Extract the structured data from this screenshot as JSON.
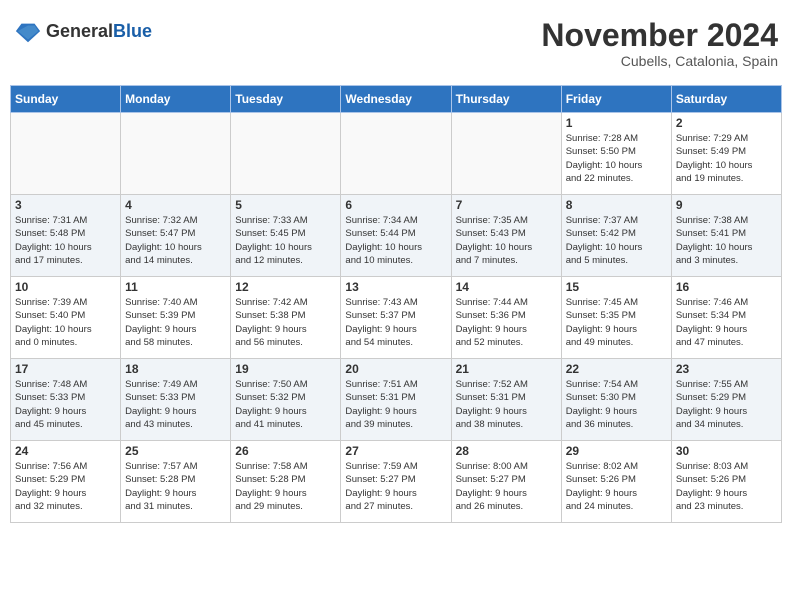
{
  "header": {
    "logo_line1": "General",
    "logo_line2": "Blue",
    "month_title": "November 2024",
    "location": "Cubells, Catalonia, Spain"
  },
  "weekdays": [
    "Sunday",
    "Monday",
    "Tuesday",
    "Wednesday",
    "Thursday",
    "Friday",
    "Saturday"
  ],
  "weeks": [
    [
      {
        "day": "",
        "info": ""
      },
      {
        "day": "",
        "info": ""
      },
      {
        "day": "",
        "info": ""
      },
      {
        "day": "",
        "info": ""
      },
      {
        "day": "",
        "info": ""
      },
      {
        "day": "1",
        "info": "Sunrise: 7:28 AM\nSunset: 5:50 PM\nDaylight: 10 hours\nand 22 minutes."
      },
      {
        "day": "2",
        "info": "Sunrise: 7:29 AM\nSunset: 5:49 PM\nDaylight: 10 hours\nand 19 minutes."
      }
    ],
    [
      {
        "day": "3",
        "info": "Sunrise: 7:31 AM\nSunset: 5:48 PM\nDaylight: 10 hours\nand 17 minutes."
      },
      {
        "day": "4",
        "info": "Sunrise: 7:32 AM\nSunset: 5:47 PM\nDaylight: 10 hours\nand 14 minutes."
      },
      {
        "day": "5",
        "info": "Sunrise: 7:33 AM\nSunset: 5:45 PM\nDaylight: 10 hours\nand 12 minutes."
      },
      {
        "day": "6",
        "info": "Sunrise: 7:34 AM\nSunset: 5:44 PM\nDaylight: 10 hours\nand 10 minutes."
      },
      {
        "day": "7",
        "info": "Sunrise: 7:35 AM\nSunset: 5:43 PM\nDaylight: 10 hours\nand 7 minutes."
      },
      {
        "day": "8",
        "info": "Sunrise: 7:37 AM\nSunset: 5:42 PM\nDaylight: 10 hours\nand 5 minutes."
      },
      {
        "day": "9",
        "info": "Sunrise: 7:38 AM\nSunset: 5:41 PM\nDaylight: 10 hours\nand 3 minutes."
      }
    ],
    [
      {
        "day": "10",
        "info": "Sunrise: 7:39 AM\nSunset: 5:40 PM\nDaylight: 10 hours\nand 0 minutes."
      },
      {
        "day": "11",
        "info": "Sunrise: 7:40 AM\nSunset: 5:39 PM\nDaylight: 9 hours\nand 58 minutes."
      },
      {
        "day": "12",
        "info": "Sunrise: 7:42 AM\nSunset: 5:38 PM\nDaylight: 9 hours\nand 56 minutes."
      },
      {
        "day": "13",
        "info": "Sunrise: 7:43 AM\nSunset: 5:37 PM\nDaylight: 9 hours\nand 54 minutes."
      },
      {
        "day": "14",
        "info": "Sunrise: 7:44 AM\nSunset: 5:36 PM\nDaylight: 9 hours\nand 52 minutes."
      },
      {
        "day": "15",
        "info": "Sunrise: 7:45 AM\nSunset: 5:35 PM\nDaylight: 9 hours\nand 49 minutes."
      },
      {
        "day": "16",
        "info": "Sunrise: 7:46 AM\nSunset: 5:34 PM\nDaylight: 9 hours\nand 47 minutes."
      }
    ],
    [
      {
        "day": "17",
        "info": "Sunrise: 7:48 AM\nSunset: 5:33 PM\nDaylight: 9 hours\nand 45 minutes."
      },
      {
        "day": "18",
        "info": "Sunrise: 7:49 AM\nSunset: 5:33 PM\nDaylight: 9 hours\nand 43 minutes."
      },
      {
        "day": "19",
        "info": "Sunrise: 7:50 AM\nSunset: 5:32 PM\nDaylight: 9 hours\nand 41 minutes."
      },
      {
        "day": "20",
        "info": "Sunrise: 7:51 AM\nSunset: 5:31 PM\nDaylight: 9 hours\nand 39 minutes."
      },
      {
        "day": "21",
        "info": "Sunrise: 7:52 AM\nSunset: 5:31 PM\nDaylight: 9 hours\nand 38 minutes."
      },
      {
        "day": "22",
        "info": "Sunrise: 7:54 AM\nSunset: 5:30 PM\nDaylight: 9 hours\nand 36 minutes."
      },
      {
        "day": "23",
        "info": "Sunrise: 7:55 AM\nSunset: 5:29 PM\nDaylight: 9 hours\nand 34 minutes."
      }
    ],
    [
      {
        "day": "24",
        "info": "Sunrise: 7:56 AM\nSunset: 5:29 PM\nDaylight: 9 hours\nand 32 minutes."
      },
      {
        "day": "25",
        "info": "Sunrise: 7:57 AM\nSunset: 5:28 PM\nDaylight: 9 hours\nand 31 minutes."
      },
      {
        "day": "26",
        "info": "Sunrise: 7:58 AM\nSunset: 5:28 PM\nDaylight: 9 hours\nand 29 minutes."
      },
      {
        "day": "27",
        "info": "Sunrise: 7:59 AM\nSunset: 5:27 PM\nDaylight: 9 hours\nand 27 minutes."
      },
      {
        "day": "28",
        "info": "Sunrise: 8:00 AM\nSunset: 5:27 PM\nDaylight: 9 hours\nand 26 minutes."
      },
      {
        "day": "29",
        "info": "Sunrise: 8:02 AM\nSunset: 5:26 PM\nDaylight: 9 hours\nand 24 minutes."
      },
      {
        "day": "30",
        "info": "Sunrise: 8:03 AM\nSunset: 5:26 PM\nDaylight: 9 hours\nand 23 minutes."
      }
    ]
  ]
}
